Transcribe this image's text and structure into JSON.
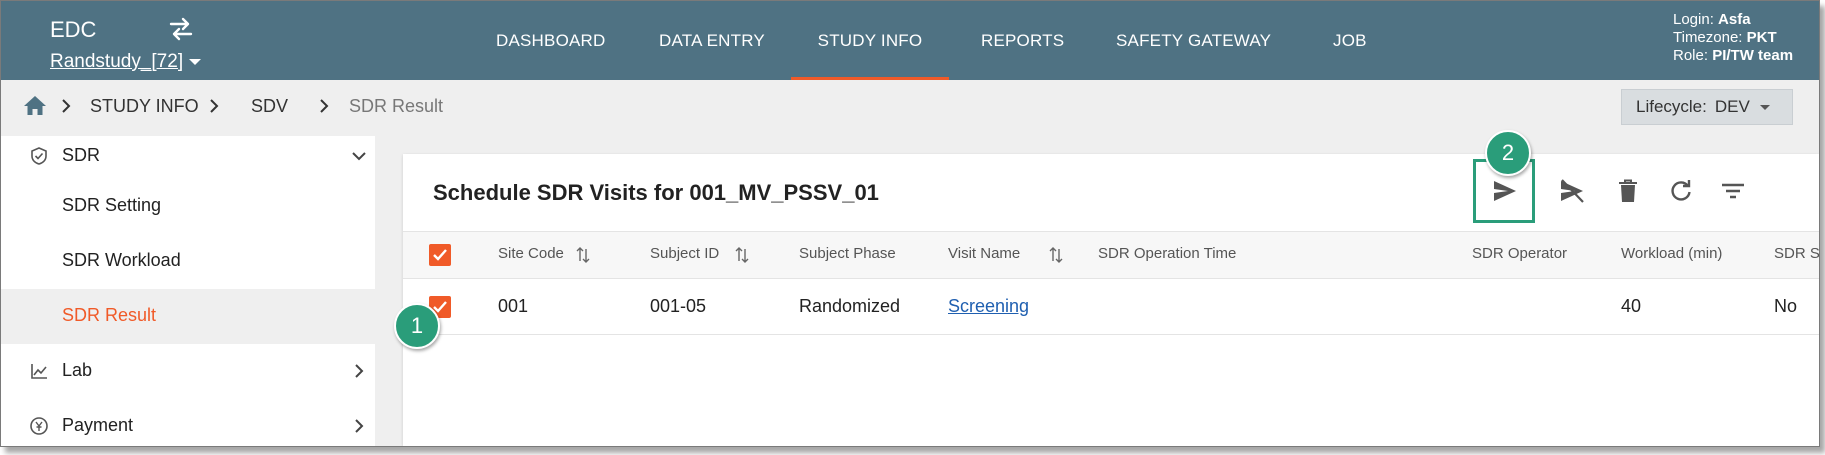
{
  "header": {
    "app_name": "EDC",
    "study": "Randstudy_[72]",
    "nav": [
      "DASHBOARD",
      "DATA ENTRY",
      "STUDY INFO",
      "REPORTS",
      "SAFETY GATEWAY",
      "JOB"
    ],
    "active_nav": "STUDY INFO",
    "user": {
      "login_label": "Login:",
      "login": "Asfa",
      "timezone_label": "Timezone:",
      "timezone": "PKT",
      "role_label": "Role:",
      "role": "PI/TW team"
    }
  },
  "breadcrumb": {
    "items": [
      "STUDY INFO",
      "SDV",
      "SDR Result"
    ]
  },
  "lifecycle": {
    "label": "Lifecycle:",
    "value": "DEV"
  },
  "sidebar": {
    "items": [
      {
        "label": "SDR",
        "icon": "shield-check-icon",
        "expanded": true
      },
      {
        "label": "SDR Setting"
      },
      {
        "label": "SDR Workload"
      },
      {
        "label": "SDR Result",
        "active": true
      },
      {
        "label": "Lab",
        "icon": "line-chart-icon"
      },
      {
        "label": "Payment",
        "icon": "currency-icon"
      }
    ]
  },
  "card": {
    "title": "Schedule SDR Visits for 001_MV_PSSV_01",
    "toolbar": [
      "send-icon",
      "cancel-send-icon",
      "trash-icon",
      "refresh-icon",
      "filter-icon"
    ]
  },
  "table": {
    "columns": [
      "Site Code",
      "Subject ID",
      "Subject Phase",
      "Visit Name",
      "SDR Operation Time",
      "SDR Operator",
      "Workload (min)",
      "SDR S"
    ],
    "rows": [
      {
        "site_code": "001",
        "subject_id": "001-05",
        "subject_phase": "Randomized",
        "visit_name": "Screening",
        "sdr_operation_time": "",
        "sdr_operator": "",
        "workload": "40",
        "sdr_s": "No"
      }
    ]
  },
  "markers": [
    "1",
    "2"
  ],
  "colors": {
    "header_bg": "#4f7283",
    "accent": "#f05a28",
    "marker": "#2a9d7a"
  }
}
